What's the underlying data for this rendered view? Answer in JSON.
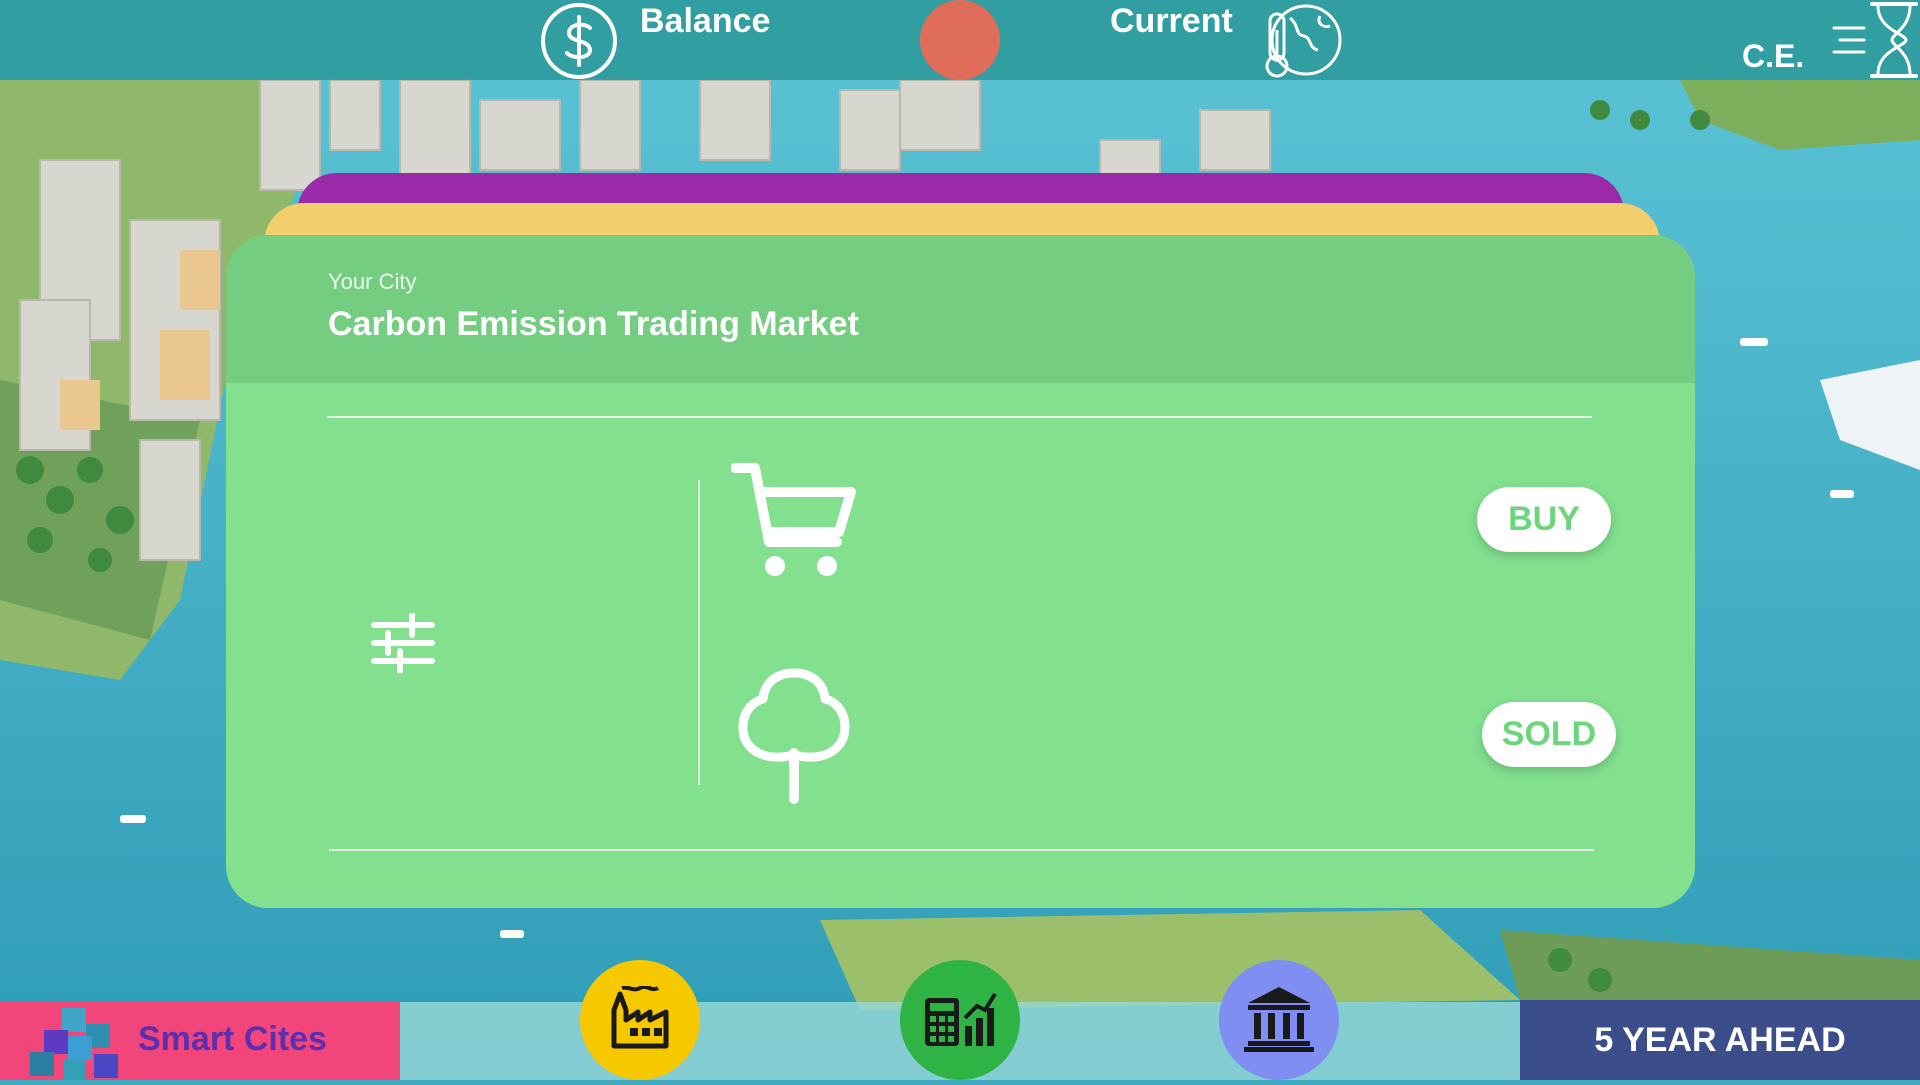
{
  "topbar": {
    "balance_label": "Balance",
    "current_label": "Current",
    "ce_label": "C.E.",
    "balance_icon": "dollar-circle-icon",
    "climate_icon": "globe-thermometer-icon",
    "hourglass_icon": "hourglass-icon",
    "status_color": "#e06c5a"
  },
  "market_card": {
    "subtitle": "Your City",
    "title": "Carbon Emission Trading Market",
    "filter_icon": "sliders-icon",
    "buy": {
      "icon": "shopping-cart-icon",
      "label": "BUY"
    },
    "sold": {
      "icon": "tree-icon",
      "label": "SOLD"
    },
    "colors": {
      "card": "#82e08f",
      "header": "#74cd80",
      "back_yellow": "#f2cf6a",
      "back_purple": "#9a2aa8"
    }
  },
  "bottombar": {
    "smart_cities_label": "Smart Cites",
    "smart_cities_icon": "cubes-icon",
    "ahead_label": "5 YEAR AHEAD",
    "buttons": [
      {
        "name": "factory",
        "icon": "factory-icon",
        "color": "#f5c800"
      },
      {
        "name": "calculator",
        "icon": "calculator-chart-icon",
        "color": "#2fb344"
      },
      {
        "name": "bank",
        "icon": "bank-icon",
        "color": "#7f8ef0"
      }
    ]
  }
}
